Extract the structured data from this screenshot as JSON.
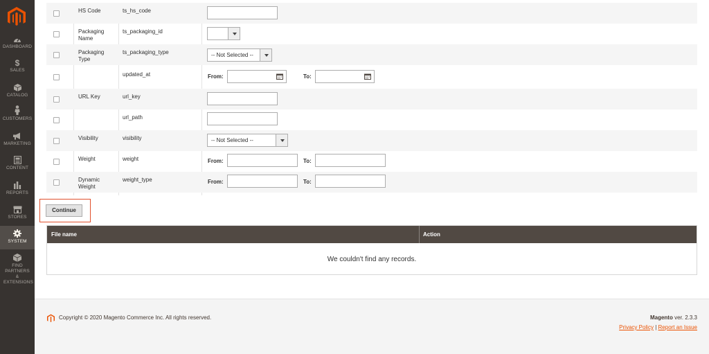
{
  "sidebar": {
    "items": [
      {
        "label": "DASHBOARD",
        "icon": "dashboard-icon"
      },
      {
        "label": "SALES",
        "icon": "dollar-icon"
      },
      {
        "label": "CATALOG",
        "icon": "cube-icon"
      },
      {
        "label": "CUSTOMERS",
        "icon": "person-icon"
      },
      {
        "label": "MARKETING",
        "icon": "megaphone-icon"
      },
      {
        "label": "CONTENT",
        "icon": "content-icon"
      },
      {
        "label": "REPORTS",
        "icon": "bar-chart-icon"
      },
      {
        "label": "STORES",
        "icon": "storefront-icon"
      },
      {
        "label": "SYSTEM",
        "icon": "gear-icon"
      },
      {
        "label": "FIND PARTNERS & EXTENSIONS",
        "icon": "extensions-icon"
      }
    ],
    "active": "SYSTEM"
  },
  "attributes": [
    {
      "label": "HS Code",
      "code": "ts_hs_code",
      "filter": "text"
    },
    {
      "label": "Packaging Name",
      "code": "ts_packaging_id",
      "filter": "select",
      "value": ""
    },
    {
      "label": "Packaging Type",
      "code": "ts_packaging_type",
      "filter": "select",
      "value": "-- Not Selected --"
    },
    {
      "label": "",
      "code": "updated_at",
      "filter": "date-range",
      "from_label": "From:",
      "to_label": "To:"
    },
    {
      "label": "URL Key",
      "code": "url_key",
      "filter": "text"
    },
    {
      "label": "",
      "code": "url_path",
      "filter": "text"
    },
    {
      "label": "Visibility",
      "code": "visibility",
      "filter": "select",
      "value": "-- Not Selected --"
    },
    {
      "label": "Weight",
      "code": "weight",
      "filter": "range",
      "from_label": "From:",
      "to_label": "To:"
    },
    {
      "label": "Dynamic Weight",
      "code": "weight_type",
      "filter": "range",
      "from_label": "From:",
      "to_label": "To:"
    }
  ],
  "continue_label": "Continue",
  "files_table": {
    "columns": [
      "File name",
      "Action"
    ],
    "empty_message": "We couldn't find any records."
  },
  "footer": {
    "copyright": "Copyright © 2020 Magento Commerce Inc. All rights reserved.",
    "brand": "Magento",
    "version": "ver. 2.3.3",
    "privacy_policy": "Privacy Policy",
    "separator": "|",
    "report_issue": "Report an Issue"
  },
  "colors": {
    "sidebar_bg": "#373330",
    "active_bg": "#524d49",
    "header_bg": "#514943",
    "logo_orange": "#eb5202",
    "highlight_border": "#e04f2b"
  }
}
